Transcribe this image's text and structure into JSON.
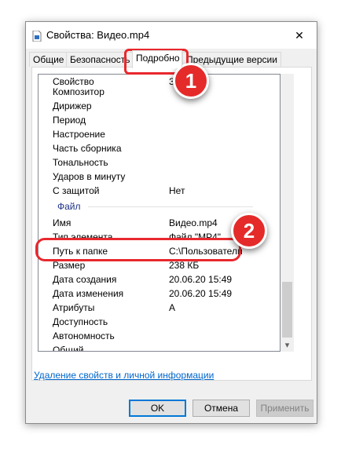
{
  "window": {
    "title": "Свойства: Видео.mp4",
    "close_glyph": "✕"
  },
  "tabs": [
    {
      "label": "Общие"
    },
    {
      "label": "Безопасность"
    },
    {
      "label": "Подробно"
    },
    {
      "label": "Предыдущие версии"
    }
  ],
  "list": {
    "rows_top": [
      {
        "name": "Свойство",
        "value": "Зна"
      },
      {
        "name": "Композитор",
        "value": ""
      },
      {
        "name": "Дирижер",
        "value": ""
      },
      {
        "name": "Период",
        "value": ""
      },
      {
        "name": "Настроение",
        "value": ""
      },
      {
        "name": "Часть сборника",
        "value": ""
      },
      {
        "name": "Тональность",
        "value": ""
      },
      {
        "name": "Ударов в минуту",
        "value": ""
      },
      {
        "name": "С защитой",
        "value": "Нет"
      }
    ],
    "group_label": "Файл",
    "rows_file": [
      {
        "name": "Имя",
        "value": "Видео.mp4"
      },
      {
        "name": "Тип элемента",
        "value": "Файл \"MP4\""
      },
      {
        "name": "Путь к папке",
        "value": "C:\\Пользователи"
      },
      {
        "name": "Размер",
        "value": "238 КБ"
      },
      {
        "name": "Дата создания",
        "value": "20.06.20 15:49"
      },
      {
        "name": "Дата изменения",
        "value": "20.06.20 15:49"
      },
      {
        "name": "Атрибуты",
        "value": "A"
      },
      {
        "name": "Доступность",
        "value": ""
      },
      {
        "name": "Автономность",
        "value": ""
      },
      {
        "name": "Общий",
        "value": ""
      }
    ],
    "scroll_down_glyph": "▾"
  },
  "link_text": "Удаление свойств и личной информации",
  "buttons": {
    "ok": "OK",
    "cancel": "Отмена",
    "apply": "Применить"
  },
  "annotations": {
    "badge1": "1",
    "badge2": "2",
    "color": "#e52a2a"
  }
}
